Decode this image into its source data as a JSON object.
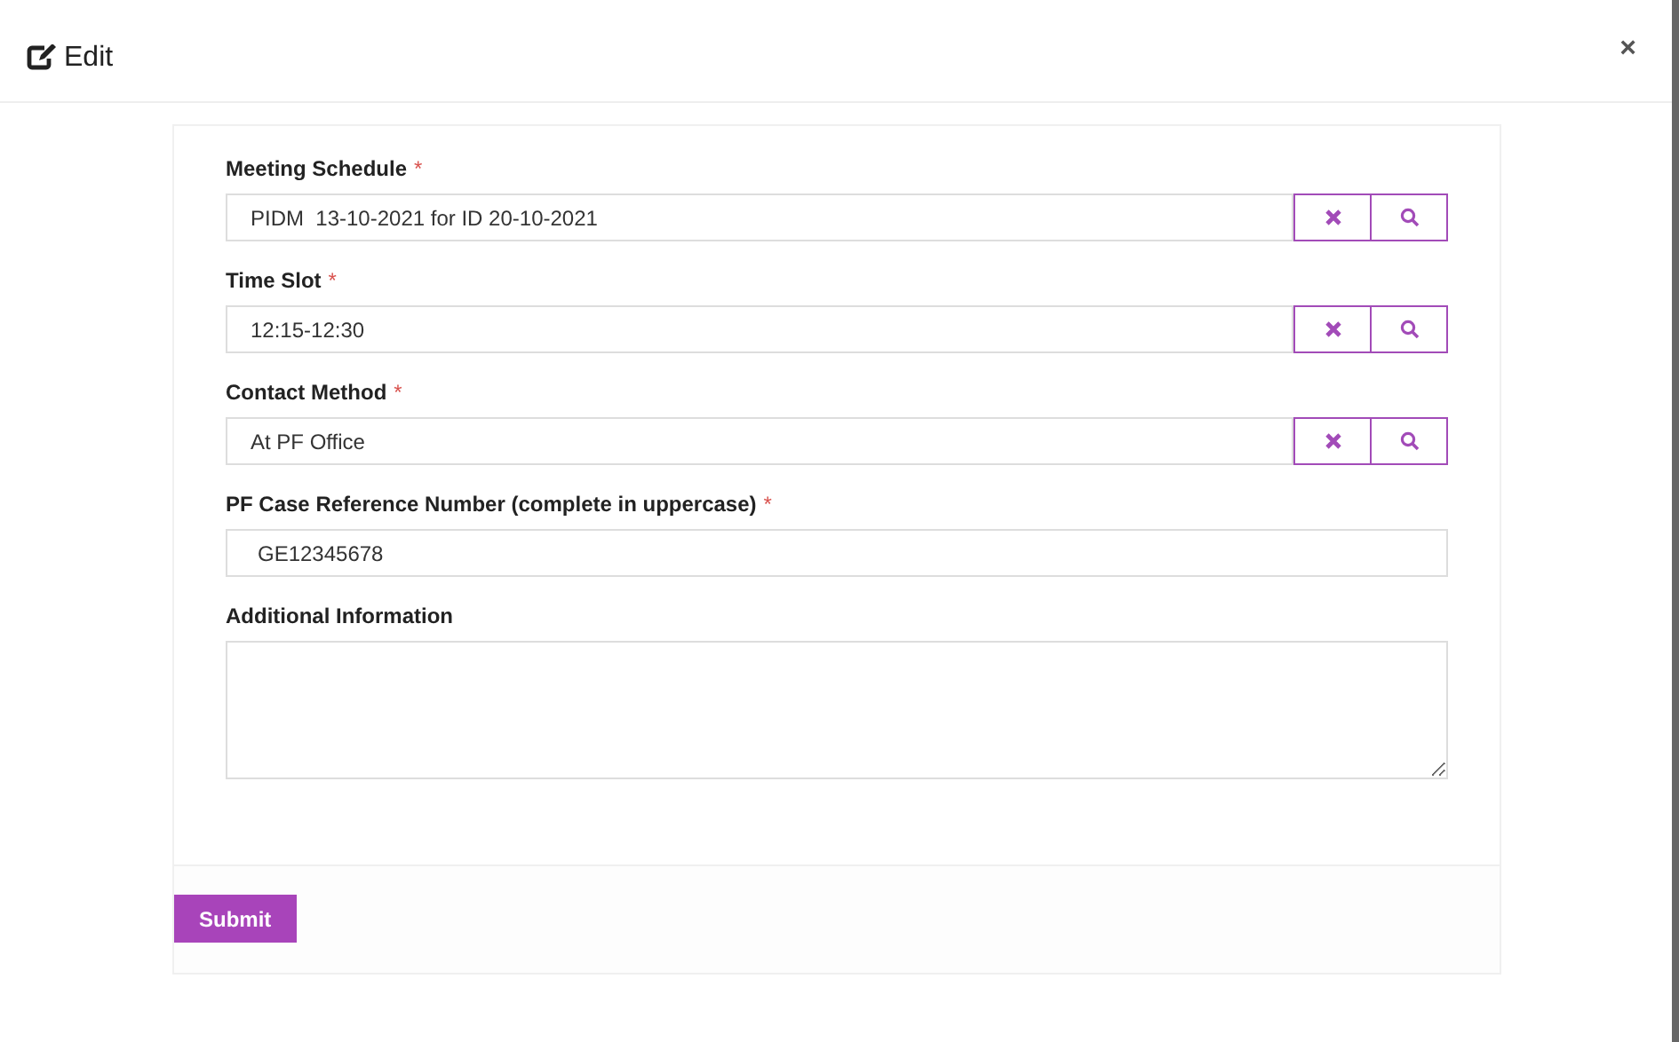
{
  "dialog": {
    "title": "Edit",
    "close": "×"
  },
  "fields": [
    {
      "kind": "lookup",
      "label": "Meeting Schedule",
      "required_mark": "*",
      "value": "PIDM  13-10-2021 for ID 20-10-2021"
    },
    {
      "kind": "lookup",
      "label": "Time Slot",
      "required_mark": "*",
      "value": "12:15-12:30"
    },
    {
      "kind": "lookup",
      "label": "Contact Method",
      "required_mark": "*",
      "value": "At PF Office"
    },
    {
      "kind": "text",
      "label": "PF Case Reference Number (complete in uppercase)",
      "required_mark": "*",
      "value": "GE12345678"
    },
    {
      "kind": "textarea",
      "label": "Additional Information"
    }
  ],
  "submit": "Submit"
}
